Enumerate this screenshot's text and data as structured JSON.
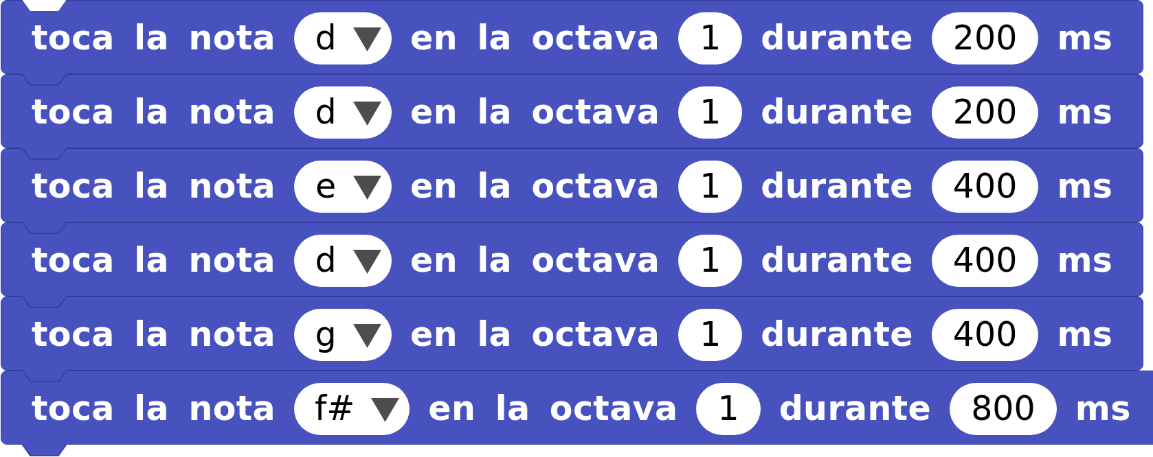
{
  "blocks": [
    {
      "parts": [
        {
          "kind": "label",
          "text": "toca la nota"
        },
        {
          "kind": "dropdown",
          "value": "d"
        },
        {
          "kind": "label",
          "text": "en la octava"
        },
        {
          "kind": "number",
          "value": "1"
        },
        {
          "kind": "label",
          "text": "durante"
        },
        {
          "kind": "number",
          "value": "200"
        },
        {
          "kind": "label",
          "text": "ms"
        }
      ]
    },
    {
      "parts": [
        {
          "kind": "label",
          "text": "toca la nota"
        },
        {
          "kind": "dropdown",
          "value": "d"
        },
        {
          "kind": "label",
          "text": "en la octava"
        },
        {
          "kind": "number",
          "value": "1"
        },
        {
          "kind": "label",
          "text": "durante"
        },
        {
          "kind": "number",
          "value": "200"
        },
        {
          "kind": "label",
          "text": "ms"
        }
      ]
    },
    {
      "parts": [
        {
          "kind": "label",
          "text": "toca la nota"
        },
        {
          "kind": "dropdown",
          "value": "e"
        },
        {
          "kind": "label",
          "text": "en la octava"
        },
        {
          "kind": "number",
          "value": "1"
        },
        {
          "kind": "label",
          "text": "durante"
        },
        {
          "kind": "number",
          "value": "400"
        },
        {
          "kind": "label",
          "text": "ms"
        }
      ]
    },
    {
      "parts": [
        {
          "kind": "label",
          "text": "toca la nota"
        },
        {
          "kind": "dropdown",
          "value": "d"
        },
        {
          "kind": "label",
          "text": "en la octava"
        },
        {
          "kind": "number",
          "value": "1"
        },
        {
          "kind": "label",
          "text": "durante"
        },
        {
          "kind": "number",
          "value": "400"
        },
        {
          "kind": "label",
          "text": "ms"
        }
      ]
    },
    {
      "parts": [
        {
          "kind": "label",
          "text": "toca la nota"
        },
        {
          "kind": "dropdown",
          "value": "g"
        },
        {
          "kind": "label",
          "text": "en la octava"
        },
        {
          "kind": "number",
          "value": "1"
        },
        {
          "kind": "label",
          "text": "durante"
        },
        {
          "kind": "number",
          "value": "400"
        },
        {
          "kind": "label",
          "text": "ms"
        }
      ]
    },
    {
      "parts": [
        {
          "kind": "label",
          "text": "toca la nota"
        },
        {
          "kind": "dropdown",
          "value": "f#"
        },
        {
          "kind": "label",
          "text": "en la octava"
        },
        {
          "kind": "number",
          "value": "1"
        },
        {
          "kind": "label",
          "text": "durante"
        },
        {
          "kind": "number",
          "value": "800"
        },
        {
          "kind": "label",
          "text": "ms"
        }
      ]
    }
  ]
}
